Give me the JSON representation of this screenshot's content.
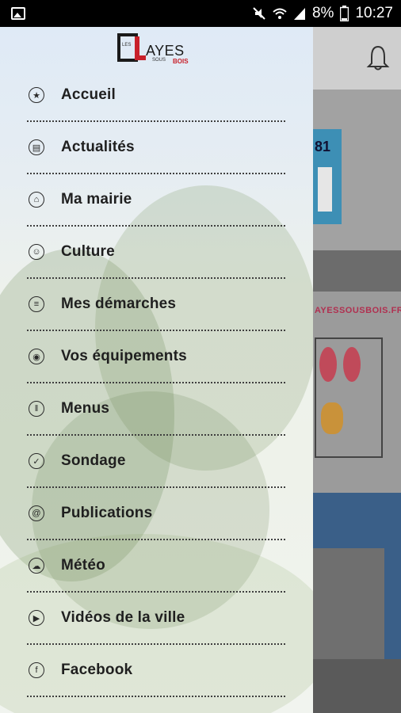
{
  "status_bar": {
    "battery": "8%",
    "time": "10:27",
    "icons": [
      "image-icon",
      "mute-icon",
      "wifi-icon",
      "signal-icon",
      "battery-icon"
    ]
  },
  "drawer": {
    "logo": {
      "prefix": "LES",
      "letter": "L",
      "main": "AYES",
      "sous": "SOUS",
      "bois": "BOIS"
    },
    "menu": [
      {
        "label": "Accueil",
        "icon": "star-icon"
      },
      {
        "label": "Actualités",
        "icon": "calendar-icon"
      },
      {
        "label": "Ma mairie",
        "icon": "town-hall-icon"
      },
      {
        "label": "Culture",
        "icon": "theater-icon"
      },
      {
        "label": "Mes démarches",
        "icon": "chat-icon"
      },
      {
        "label": "Vos équipements",
        "icon": "facility-icon"
      },
      {
        "label": "Menus",
        "icon": "cutlery-icon"
      },
      {
        "label": "Sondage",
        "icon": "check-icon"
      },
      {
        "label": "Publications",
        "icon": "document-icon"
      },
      {
        "label": "Météo",
        "icon": "weather-icon"
      },
      {
        "label": "Vidéos de la ville",
        "icon": "play-icon"
      },
      {
        "label": "Facebook",
        "icon": "facebook-icon"
      }
    ]
  },
  "background": {
    "banner_text": "AYESSOUSBOIS.FR",
    "card_number": "81",
    "bell_icon": "bell-icon"
  }
}
